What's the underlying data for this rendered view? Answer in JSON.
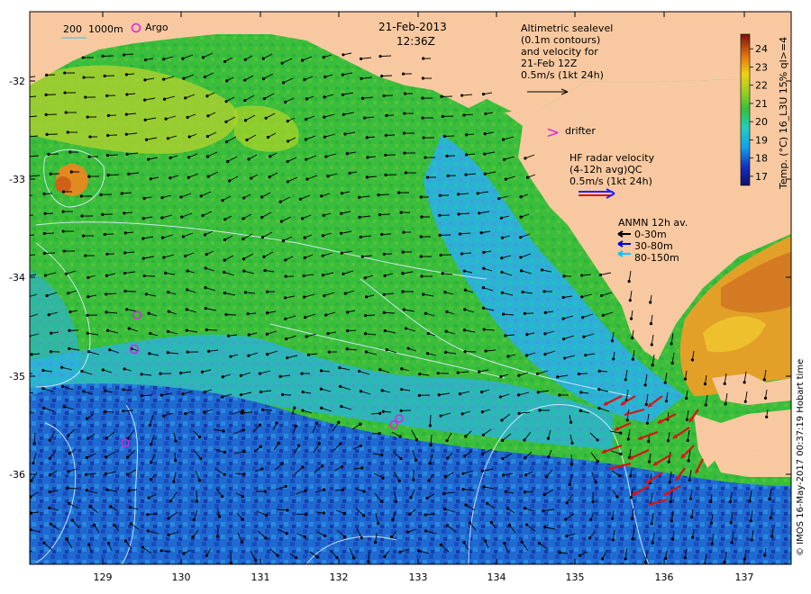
{
  "header": {
    "date": "21-Feb-2013",
    "time": "12:36Z"
  },
  "scale": {
    "depth_label": "200",
    "depth_label2": "1000m",
    "argo_label": "Argo"
  },
  "altimetry": {
    "lines": [
      "Altimetric sealevel",
      "(0.1m contours)",
      "and velocity for",
      "21-Feb 12Z",
      "0.5m/s (1kt 24h)"
    ]
  },
  "drifter": {
    "label": "drifter",
    "symbol": ">"
  },
  "hf_radar": {
    "lines": [
      "HF radar velocity",
      "(4-12h avg)QC",
      "0.5m/s (1kt 24h)"
    ]
  },
  "anmn": {
    "title": "ANMN 12h av.",
    "items": [
      {
        "label": "0-30m",
        "color": "#000000"
      },
      {
        "label": "30-80m",
        "color": "#0000dd"
      },
      {
        "label": "80-150m",
        "color": "#00c8ff"
      }
    ]
  },
  "colorbar": {
    "title": "Temp. (°C) 16_L3U 15% ql>=4",
    "ticks": [
      "24",
      "23",
      "22",
      "21",
      "20",
      "19",
      "18",
      "17"
    ],
    "range": [
      16.5,
      24.8
    ]
  },
  "axes": {
    "lat_labels": [
      "-32",
      "-33",
      "-34",
      "-35",
      "-36"
    ],
    "lon_labels": [
      "129",
      "130",
      "131",
      "132",
      "133",
      "134",
      "135",
      "136",
      "137"
    ]
  },
  "credit": "© IMOS 16-May-2017 00:37:19 Hobart time",
  "colors": {
    "land": "#f8c9a0",
    "warm": "#f0b020",
    "green": "#3cbe3c",
    "cyan": "#30b8e6",
    "blue": "#1e5acc",
    "radar": "#dd1111",
    "argo": "#dd22dd"
  }
}
